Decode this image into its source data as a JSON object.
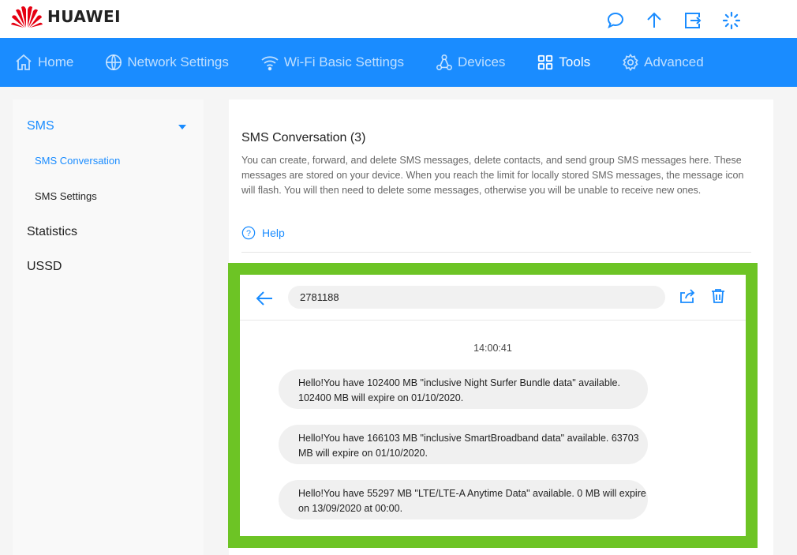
{
  "brand": {
    "name": "HUAWEI",
    "accent": "#1a8cff",
    "highlight": "#6dc425"
  },
  "top_icons": [
    {
      "name": "message-icon"
    },
    {
      "name": "upload-icon"
    },
    {
      "name": "logout-icon"
    },
    {
      "name": "loading-icon"
    }
  ],
  "nav": {
    "items": [
      {
        "label": "Home",
        "icon": "home-icon"
      },
      {
        "label": "Network Settings",
        "icon": "globe-icon"
      },
      {
        "label": "Wi-Fi Basic Settings",
        "icon": "wifi-icon"
      },
      {
        "label": "Devices",
        "icon": "devices-icon"
      },
      {
        "label": "Tools",
        "icon": "tools-icon",
        "active": true
      },
      {
        "label": "Advanced",
        "icon": "gear-icon"
      }
    ]
  },
  "sidebar": {
    "sms": "SMS",
    "sms_conversation": "SMS Conversation",
    "sms_settings": "SMS Settings",
    "statistics": "Statistics",
    "ussd": "USSD"
  },
  "main": {
    "title": "SMS Conversation (3)",
    "description": "You can create, forward, and delete SMS messages, delete contacts, and send group SMS messages here. These messages are stored on your device. When you reach the limit for locally stored SMS messages, the message icon will flash. You will then need to delete some messages, otherwise you will be unable to receive new ones.",
    "help": "Help"
  },
  "conversation": {
    "number": "2781188",
    "time": "14:00:41",
    "messages": [
      "Hello!You have 102400 MB \"inclusive Night Surfer Bundle data\" available. 102400 MB will expire on 01/10/2020.",
      "Hello!You have 166103 MB \"inclusive SmartBroadband data\" available. 63703 MB will expire on 01/10/2020.",
      "Hello!You have 55297 MB \"LTE/LTE-A Anytime Data\" available. 0 MB will expire on 13/09/2020 at 00:00."
    ]
  }
}
